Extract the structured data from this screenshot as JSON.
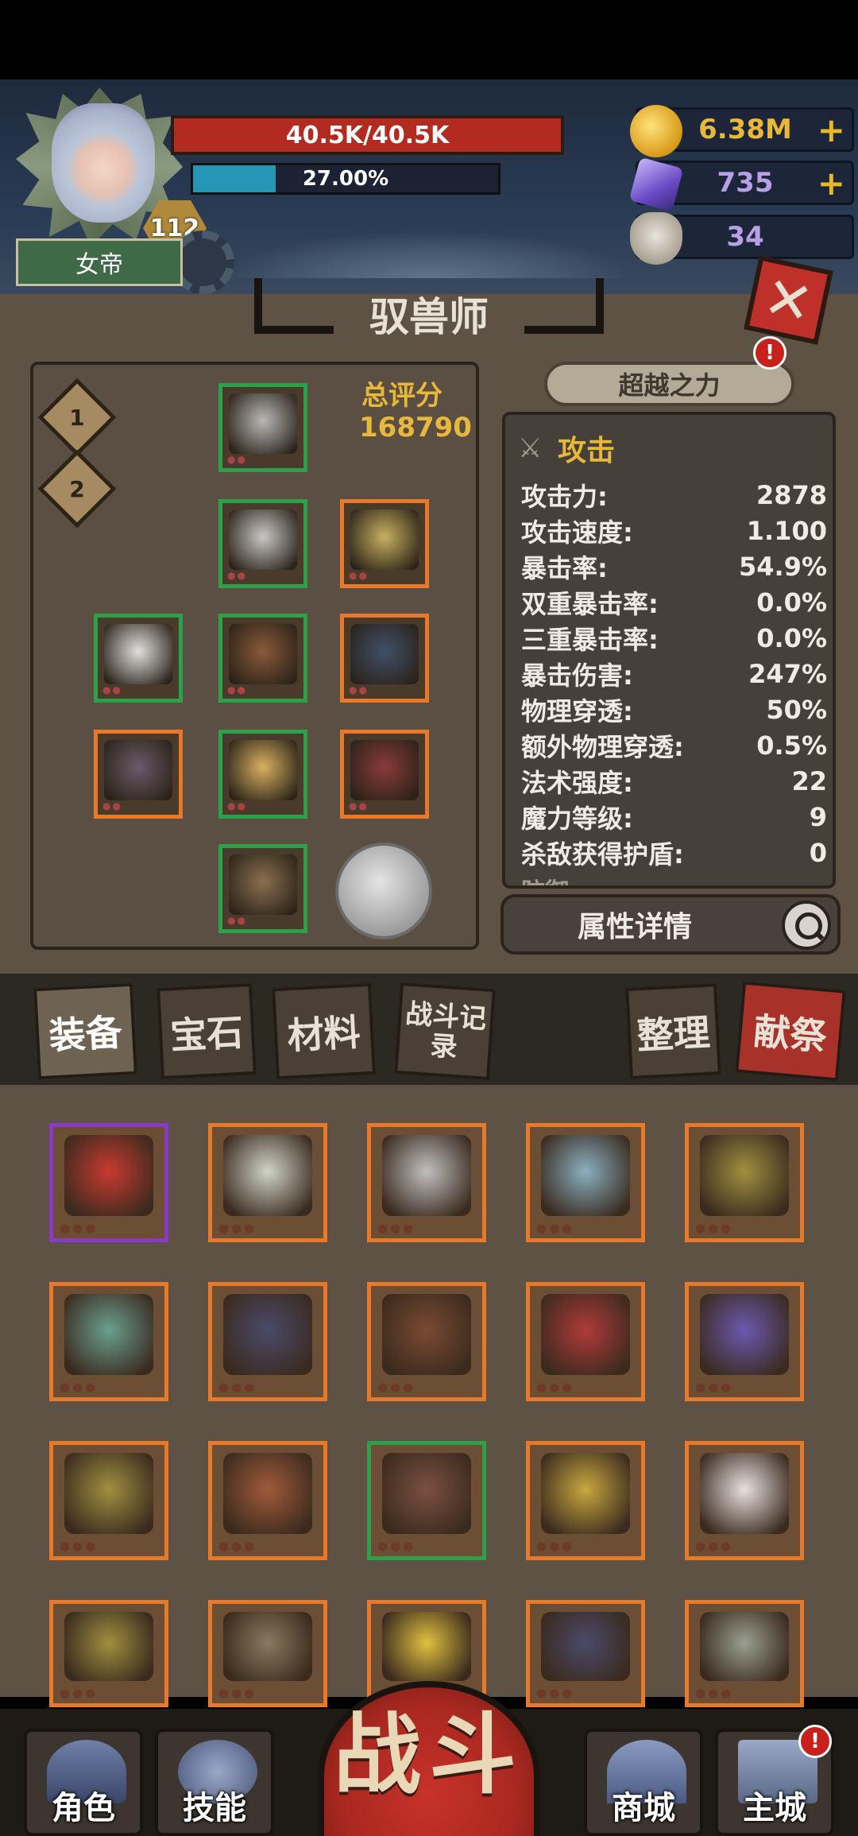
{
  "header": {
    "hp_text": "40.5K/40.5K",
    "xp_percent": 27.0,
    "xp_text": "27.00%",
    "level": "112",
    "title": "女帝"
  },
  "currencies": [
    {
      "icon": "gold-coin-icon",
      "value": "6.38M",
      "plus": "+",
      "color": "#e8b83a"
    },
    {
      "icon": "purple-crystal-icon",
      "value": "735",
      "plus": "+",
      "color": "#b8a0e8"
    },
    {
      "icon": "ram-skull-icon",
      "value": "34",
      "plus": "",
      "color": "#b8a0e8"
    }
  ],
  "close_label": "✕",
  "panel": {
    "title": "驭兽师",
    "loadouts": [
      "1",
      "2"
    ],
    "score_label": "总评分",
    "score_value": "168790",
    "transcend_label": "超越之力",
    "alert": "!"
  },
  "stats": {
    "heading": "攻击",
    "rows": [
      {
        "label": "攻击力:",
        "value": "2878"
      },
      {
        "label": "攻击速度:",
        "value": "1.100"
      },
      {
        "label": "暴击率:",
        "value": "54.9%"
      },
      {
        "label": "双重暴击率:",
        "value": "0.0%"
      },
      {
        "label": "三重暴击率:",
        "value": "0.0%"
      },
      {
        "label": "暴击伤害:",
        "value": "247%"
      },
      {
        "label": "物理穿透:",
        "value": "50%"
      },
      {
        "label": "额外物理穿透:",
        "value": "0.5%"
      },
      {
        "label": "法术强度:",
        "value": "22"
      },
      {
        "label": "魔力等级:",
        "value": "9"
      },
      {
        "label": "杀敌获得护盾:",
        "value": "0"
      }
    ],
    "next_heading": "防御",
    "detail_button": "属性详情"
  },
  "tabs": {
    "equipment": "装备",
    "gems": "宝石",
    "materials": "材料",
    "battle_log": "战斗记录",
    "sort": "整理",
    "sacrifice": "献祭"
  },
  "equipped": [
    {
      "slot": "helmet",
      "rarity": "g",
      "color": "#b8b8b8"
    },
    {
      "slot": "armor",
      "rarity": "g",
      "color": "#c8c8c8"
    },
    {
      "slot": "bracer",
      "rarity": "o",
      "color": "#c8b060"
    },
    {
      "slot": "shoulder",
      "rarity": "g",
      "color": "#e0e0e0"
    },
    {
      "slot": "belt",
      "rarity": "g",
      "color": "#8a5a3a"
    },
    {
      "slot": "necklace",
      "rarity": "o",
      "color": "#40506a"
    },
    {
      "slot": "bow",
      "rarity": "o",
      "color": "#6a5a6a"
    },
    {
      "slot": "gauntlets",
      "rarity": "g",
      "color": "#d8b060"
    },
    {
      "slot": "crossbow",
      "rarity": "o",
      "color": "#8a3a3a"
    },
    {
      "slot": "boots",
      "rarity": "g",
      "color": "#8a7050"
    }
  ],
  "inventory": [
    {
      "name": "red-skirt",
      "rarity": "p",
      "color": "#c83a30"
    },
    {
      "name": "crossbow",
      "rarity": "o",
      "color": "#d0d4c8"
    },
    {
      "name": "war-axe",
      "rarity": "o",
      "color": "#c0c0c0"
    },
    {
      "name": "blue-crossbow",
      "rarity": "o",
      "color": "#8ab0c0"
    },
    {
      "name": "gold-helmet",
      "rarity": "o",
      "color": "#a09040"
    },
    {
      "name": "green-shorts",
      "rarity": "o",
      "color": "#6aa090"
    },
    {
      "name": "demon-necklace",
      "rarity": "o",
      "color": "#4a4a6a"
    },
    {
      "name": "leather-boots",
      "rarity": "o",
      "color": "#7a4a32"
    },
    {
      "name": "red-crossbow",
      "rarity": "o",
      "color": "#b03a3a"
    },
    {
      "name": "purple-belt",
      "rarity": "o",
      "color": "#6a5ab0"
    },
    {
      "name": "gold-helmet",
      "rarity": "o",
      "color": "#a09040"
    },
    {
      "name": "cowboy-hat",
      "rarity": "o",
      "color": "#a05a3a"
    },
    {
      "name": "leather-pants",
      "rarity": "g",
      "color": "#7a5040"
    },
    {
      "name": "sun-belt",
      "rarity": "o",
      "color": "#c8a840"
    },
    {
      "name": "fur-hat",
      "rarity": "o",
      "color": "#e8e0e0"
    },
    {
      "name": "gold-helmet",
      "rarity": "o",
      "color": "#a09040"
    },
    {
      "name": "cloth-pants",
      "rarity": "o",
      "color": "#8a7a60"
    },
    {
      "name": "flower-necklace",
      "rarity": "o",
      "color": "#e0c040"
    },
    {
      "name": "demon-necklace",
      "rarity": "o",
      "color": "#4a4a6a"
    },
    {
      "name": "claw-crossbow",
      "rarity": "o",
      "color": "#9aa090"
    }
  ],
  "nav": {
    "role": "角色",
    "skills": "技能",
    "battle": "战斗",
    "shop": "商城",
    "city": "主城",
    "alert": "!"
  }
}
